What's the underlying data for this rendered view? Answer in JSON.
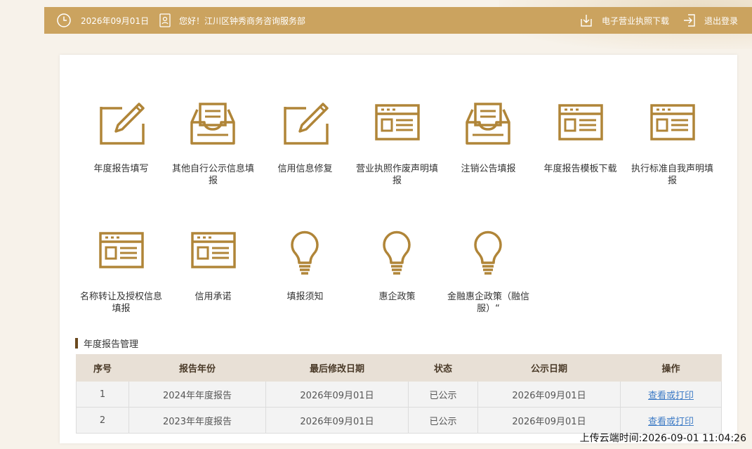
{
  "topbar": {
    "date": "2026年09月01日",
    "greeting": "您好！江川区钟秀商务咨询服务部",
    "download_license": "电子营业执照下载",
    "logout": "退出登录"
  },
  "tiles": [
    {
      "label": "年度报告填写",
      "icon": "edit-icon"
    },
    {
      "label": "其他自行公示信息填报",
      "icon": "inbox-icon"
    },
    {
      "label": "信用信息修复",
      "icon": "edit-icon"
    },
    {
      "label": "营业执照作废声明填报",
      "icon": "window-form-icon"
    },
    {
      "label": "注销公告填报",
      "icon": "inbox-icon"
    },
    {
      "label": "年度报告模板下载",
      "icon": "window-form-icon"
    },
    {
      "label": "执行标准自我声明填报",
      "icon": "window-form-icon"
    },
    {
      "label": "名称转让及授权信息填报",
      "icon": "window-form-icon"
    },
    {
      "label": "信用承诺",
      "icon": "window-form-icon"
    },
    {
      "label": "填报须知",
      "icon": "lightbulb-icon"
    },
    {
      "label": "惠企政策",
      "icon": "lightbulb-icon"
    },
    {
      "label": "金融惠企政策（融信服）“",
      "icon": "lightbulb-icon"
    }
  ],
  "section": {
    "title": "年度报告管理"
  },
  "table": {
    "headers": [
      "序号",
      "报告年份",
      "最后修改日期",
      "状态",
      "公示日期",
      "操作"
    ],
    "rows": [
      {
        "no": "1",
        "year": "2024年年度报告",
        "modified": "2026年09月01日",
        "status": "已公示",
        "public_date": "2026年09月01日",
        "action": "查看或打印"
      },
      {
        "no": "2",
        "year": "2023年年度报告",
        "modified": "2026年09月01日",
        "status": "已公示",
        "public_date": "2026年09月01日",
        "action": "查看或打印"
      }
    ]
  },
  "footer": {
    "upload_time": "上传云端时间:2026-09-01 11:04:26"
  },
  "colors": {
    "accent": "#cba35f",
    "icon": "#b08538",
    "header_bg": "#e8e0d6"
  }
}
